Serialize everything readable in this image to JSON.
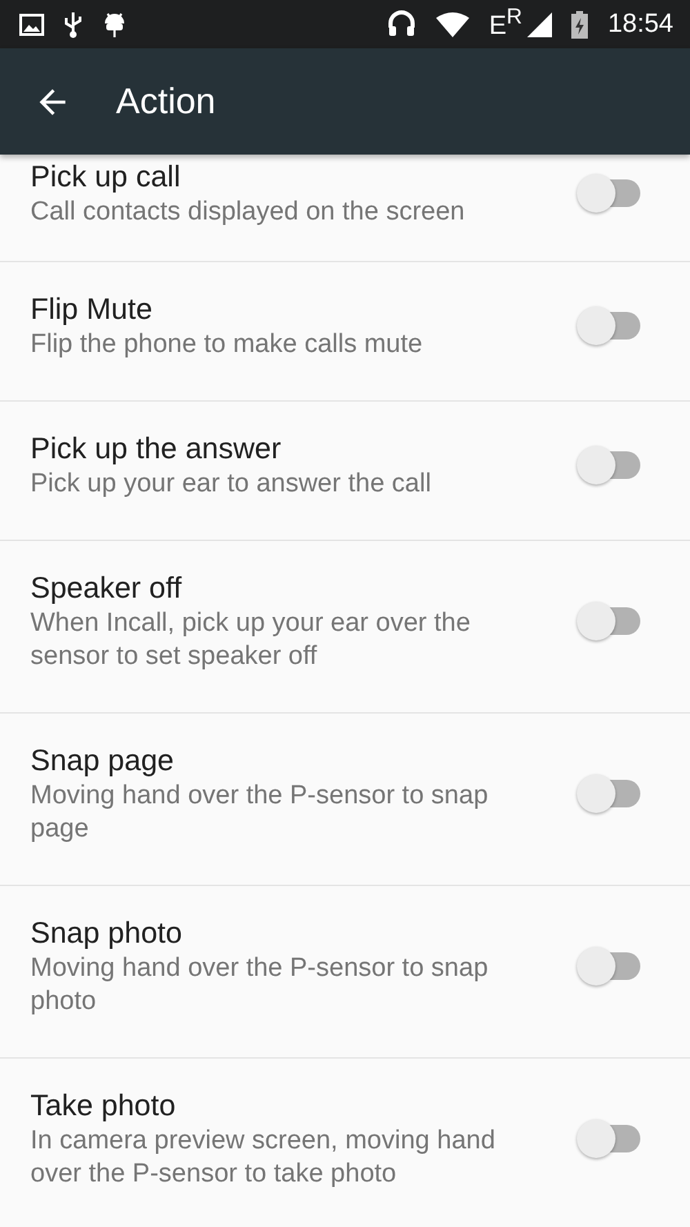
{
  "status_bar": {
    "network": "E$^{R}$",
    "time": "18:54"
  },
  "toolbar": {
    "title": "Action"
  },
  "settings": [
    {
      "title": "Pick up call",
      "summary": "Call contacts displayed on the screen",
      "on": false,
      "cut_top": true
    },
    {
      "title": "Flip Mute",
      "summary": "Flip the phone to make calls mute",
      "on": false
    },
    {
      "title": "Pick up the answer",
      "summary": "Pick up your ear to answer the call",
      "on": false
    },
    {
      "title": "Speaker off",
      "summary": "When Incall, pick up your ear over the sensor to set speaker off",
      "on": false
    },
    {
      "title": "Snap page",
      "summary": "Moving hand over the P-sensor to snap page",
      "on": false
    },
    {
      "title": "Snap photo",
      "summary": "Moving hand over the P-sensor to snap photo",
      "on": false
    },
    {
      "title": "Take photo",
      "summary": "In camera preview screen, moving hand over the P-sensor to take photo",
      "on": false
    }
  ]
}
